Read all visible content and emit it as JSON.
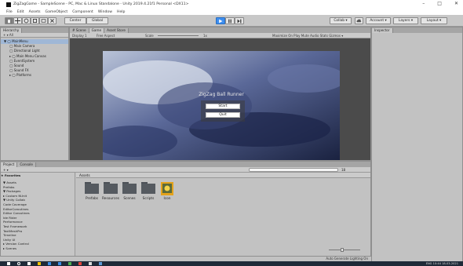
{
  "window": {
    "title": "ZigZagGame - SampleScene - PC, Mac & Linux Standalone - Unity 2019.4.21f1 Personal <DX11>",
    "controls": [
      "–",
      "□",
      "✕"
    ]
  },
  "menu": [
    "File",
    "Edit",
    "Assets",
    "GameObject",
    "Component",
    "Window",
    "Help"
  ],
  "toolbar": {
    "pivot_label": "Center",
    "space_label": "Global",
    "collab_label": "Collab ▾",
    "account_label": "Account ▾",
    "layers_label": "Layers ▾",
    "layout_label": "Layout ▾",
    "colors": {
      "play": "#3d8ef0"
    }
  },
  "hierarchy": {
    "tab": "Hierarchy",
    "search_label": "+ ▾ All",
    "items": [
      {
        "label": "▼ ◯ MainMenu",
        "depth": 0,
        "selected": true
      },
      {
        "label": "◯ Main Camera",
        "depth": 1
      },
      {
        "label": "◯ Directional Light",
        "depth": 1
      },
      {
        "label": "▸ ◯ Main Menu Canvas",
        "depth": 1
      },
      {
        "label": "◯ EventSystem",
        "depth": 1
      },
      {
        "label": "◯ Sound",
        "depth": 1
      },
      {
        "label": "◯ Sound FX",
        "depth": 1
      },
      {
        "label": "▸ ◯ Platforms",
        "depth": 1
      }
    ]
  },
  "center_tabs": [
    "# Scene",
    "Game",
    "Asset Store"
  ],
  "game_controls": {
    "display": "Display 1",
    "aspect": "Free Aspect",
    "scale_label": "Scale",
    "scale_value": "1x",
    "options": "Maximize On Play   Mute Audio   Stats   Gizmos ▾"
  },
  "game": {
    "title": "ZigZag Ball Runner",
    "buttons": [
      "Start",
      "Quit"
    ]
  },
  "inspector": {
    "tab": "Inspector"
  },
  "project": {
    "tabs": [
      "Project",
      "Console"
    ],
    "tree_header": "★ Favorites",
    "tree": [
      "▼ Assets",
      "   Prefabs",
      "▼ Packages",
      "  ▸ Custom NUnit",
      "  ▼ Unity Collab",
      "     Code Coverage",
      "     EditorCoroutines",
      "     Editor Coroutines",
      "     Ide Rider",
      "     Performance",
      "     Test Framework",
      "     TextMeshPro",
      "     Timeline",
      "     Unity UI",
      "  ▸ Version Control",
      "▸ Scenes"
    ],
    "breadcrumb": "Assets",
    "count_label": "18",
    "assets": [
      {
        "label": "Prefabs",
        "icon": "folder-icon"
      },
      {
        "label": "Resources",
        "icon": "folder-icon"
      },
      {
        "label": "Scenes",
        "icon": "folder-icon"
      },
      {
        "label": "Scripts",
        "icon": "folder-icon"
      },
      {
        "label": "Icon",
        "icon": "image-asset-icon"
      }
    ]
  },
  "status": {
    "text": "Auto Generate Lighting On"
  },
  "taskbar": {
    "icons": [
      "windows-start-icon",
      "search-icon",
      "task-view-icon",
      "file-explorer-icon",
      "mail-icon",
      "store-icon",
      "chrome-icon",
      "app-icon",
      "unity-icon",
      "app-icon"
    ],
    "tray": "ENG  10:44  18-03-2021"
  }
}
